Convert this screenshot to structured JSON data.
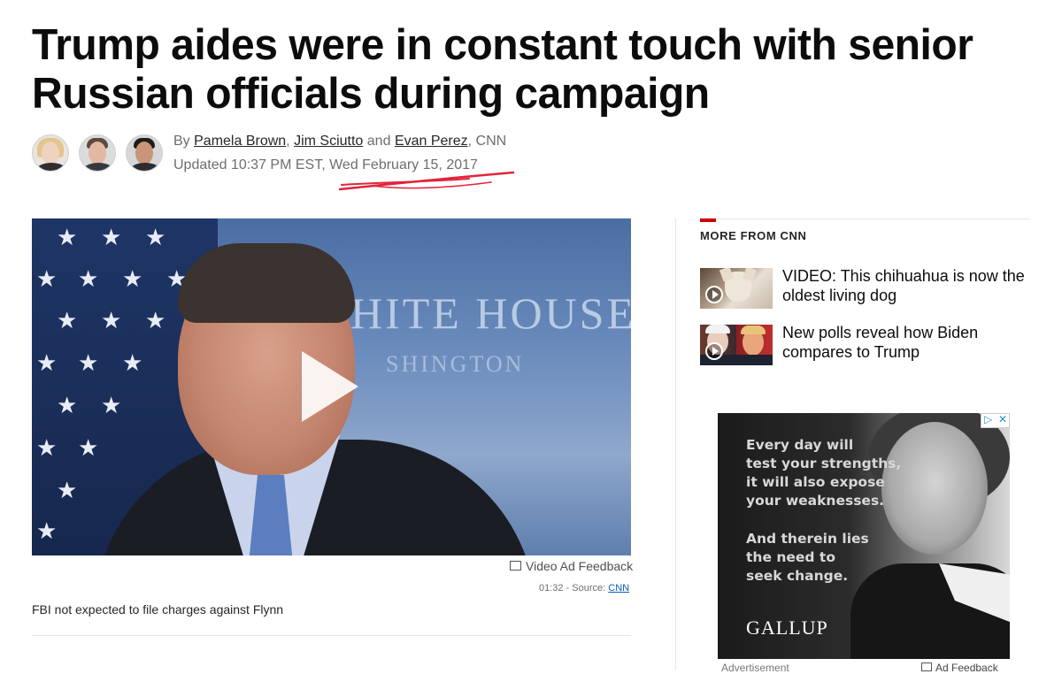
{
  "article": {
    "headline": "Trump aides were in constant touch with senior Russian officials during campaign",
    "byline_prefix": "By",
    "authors": [
      "Pamela Brown",
      "Jim Sciutto",
      "Evan Perez"
    ],
    "byline_sep1": ",",
    "byline_and": "and",
    "byline_suffix": ", CNN",
    "updated": "Updated 10:37 PM EST, Wed February 15, 2017"
  },
  "video": {
    "wall_text": "HITE HOUSE",
    "wall_subtext": "SHINGTON",
    "ad_feedback_label": "Video Ad Feedback",
    "duration_source": "01:32 - Source:",
    "source_link": "CNN",
    "caption": "FBI not expected to file charges against Flynn"
  },
  "sidebar": {
    "section_title": "MORE FROM CNN",
    "stories": [
      {
        "title": "VIDEO: This chihuahua is now the oldest living dog",
        "has_video": true
      },
      {
        "title": "New polls reveal how Biden compares to Trump",
        "has_video": true
      }
    ]
  },
  "ad": {
    "text_lines_1": [
      "Every day will",
      "test your strengths,",
      "it will also expose",
      "your weaknesses."
    ],
    "text_lines_2": [
      "And therein lies",
      "the need to",
      "seek change."
    ],
    "brand": "GALLUP",
    "label": "Advertisement",
    "feedback_label": "Ad Feedback"
  },
  "colors": {
    "accent_red": "#cc0000",
    "link_blue": "#0c5fb5",
    "annotation_red": "#e0253c"
  }
}
